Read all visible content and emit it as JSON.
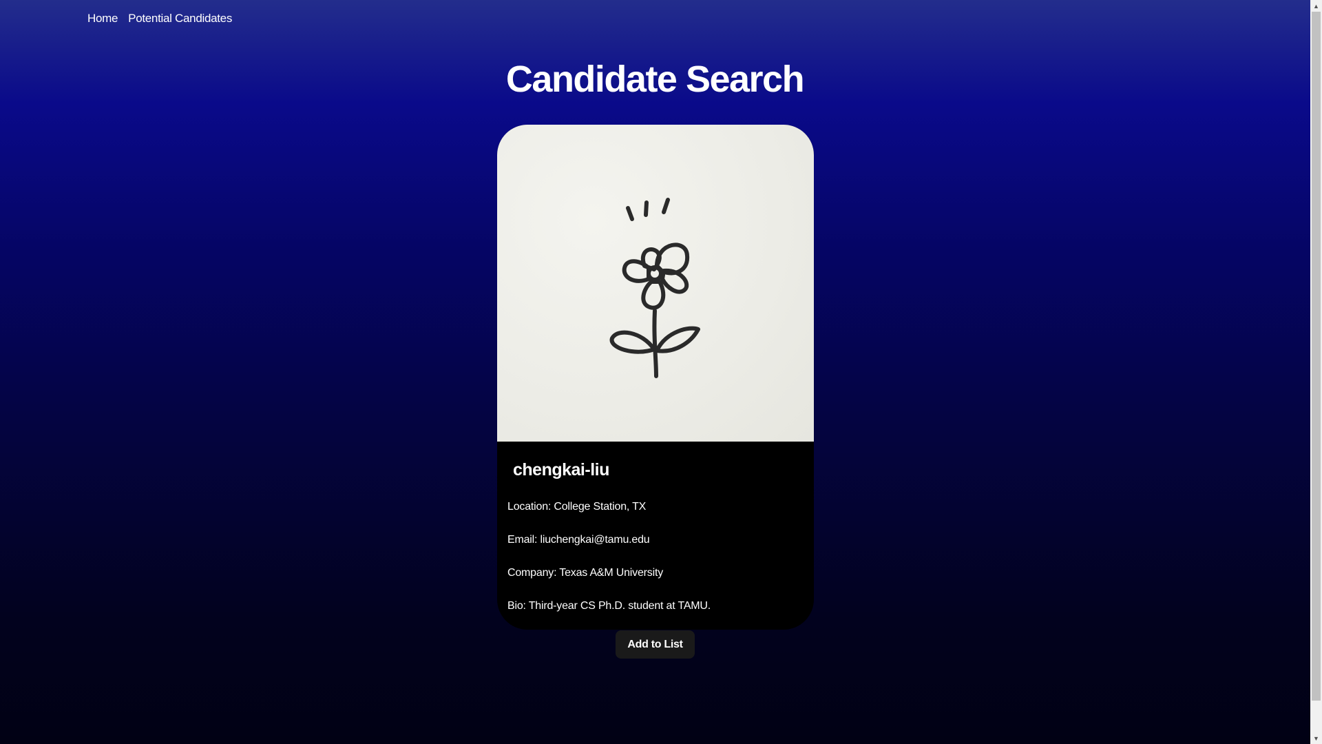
{
  "nav": {
    "items": [
      {
        "label": "Home"
      },
      {
        "label": "Potential Candidates"
      }
    ]
  },
  "page": {
    "title": "Candidate Search"
  },
  "candidate": {
    "avatar_icon": "flower-drawing",
    "username": "chengkai-liu",
    "location": "Location: College Station, TX",
    "email": "Email: liuchengkai@tamu.edu",
    "company": "Company: Texas A&M University",
    "bio": "Bio: Third-year CS Ph.D. student at TAMU."
  },
  "actions": {
    "add_label": "Add to List"
  },
  "colors": {
    "background_top": "#232d8c",
    "background_bottom": "#010114",
    "card_background": "#000000",
    "button_background": "#1a1a1a",
    "text": "#ffffff"
  }
}
